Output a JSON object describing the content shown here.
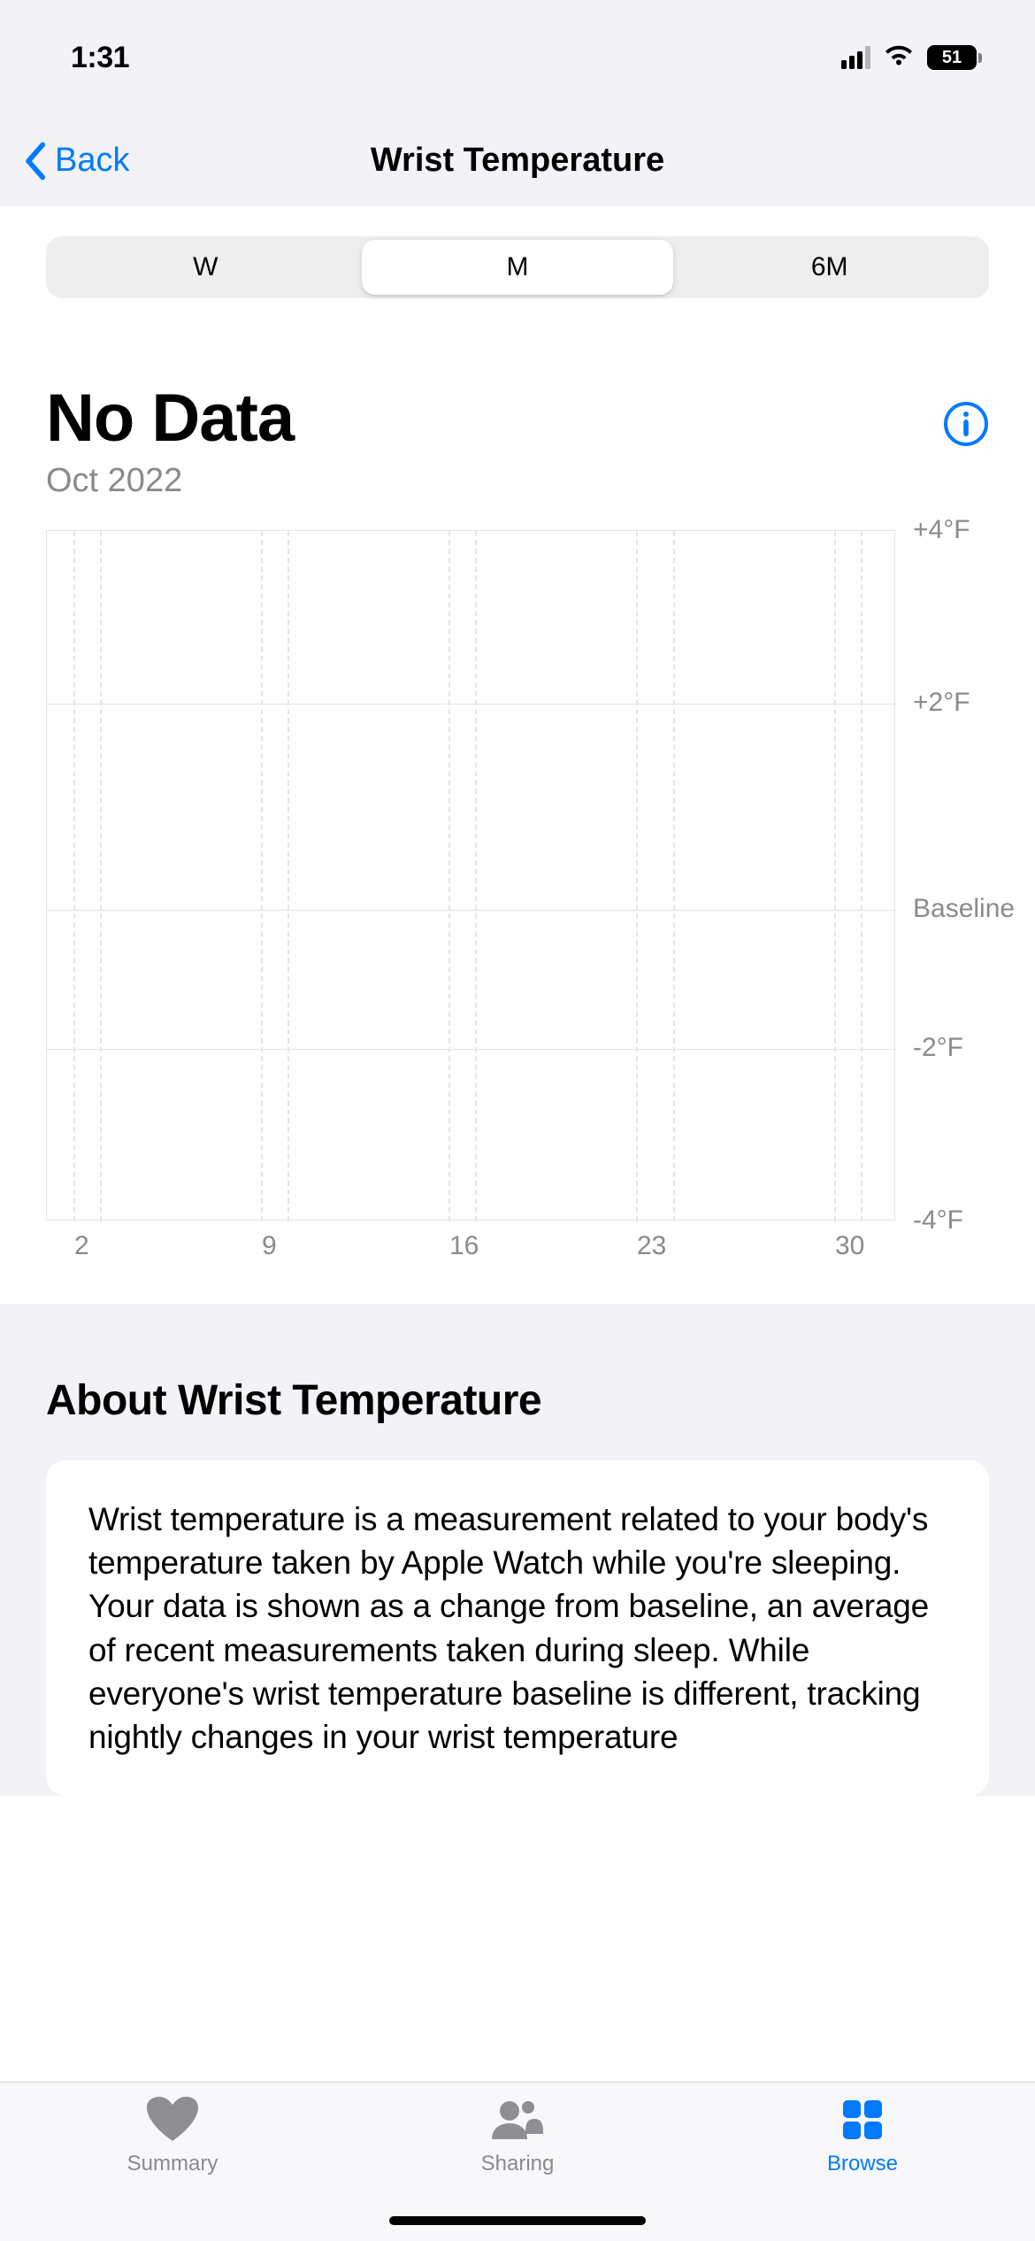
{
  "status": {
    "time": "1:31",
    "battery": "51"
  },
  "nav": {
    "back": "Back",
    "title": "Wrist Temperature"
  },
  "segmented": {
    "items": [
      {
        "label": "W",
        "selected": false
      },
      {
        "label": "M",
        "selected": true
      },
      {
        "label": "6M",
        "selected": false
      }
    ]
  },
  "headline": {
    "value": "No Data",
    "period": "Oct 2022"
  },
  "chart_data": {
    "type": "line",
    "title": "Wrist Temperature change from baseline",
    "xlabel": "",
    "ylabel": "",
    "x_ticks": [
      "2",
      "9",
      "16",
      "23",
      "30"
    ],
    "y_ticks": [
      "+4°F",
      "+2°F",
      "Baseline",
      "-2°F",
      "-4°F"
    ],
    "ylim": [
      -4,
      4
    ],
    "series": [
      {
        "name": "Wrist Temperature",
        "values": []
      }
    ]
  },
  "about": {
    "title": "About Wrist Temperature",
    "body": "Wrist temperature is a measurement related to your body's temperature taken by Apple Watch while you're sleeping. Your data is shown as a change from baseline, an average of recent measurements taken during sleep. While everyone's wrist temperature baseline is different, tracking nightly changes in your wrist temperature"
  },
  "tabs": {
    "items": [
      {
        "label": "Summary",
        "active": false
      },
      {
        "label": "Sharing",
        "active": false
      },
      {
        "label": "Browse",
        "active": true
      }
    ]
  }
}
